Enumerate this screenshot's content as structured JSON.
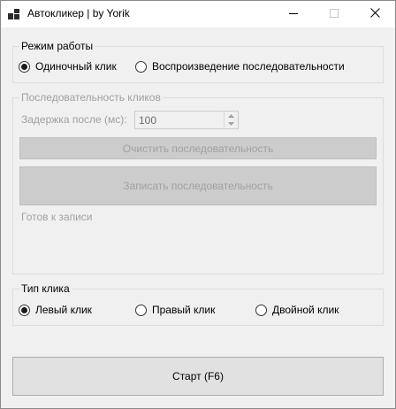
{
  "window": {
    "title": "Автокликер | by Yorik",
    "icon": "app-icon",
    "controls": [
      "minimize-icon",
      "maximize-icon",
      "close-icon"
    ]
  },
  "mode_group": {
    "legend": "Режим работы",
    "options": [
      {
        "label": "Одиночный клик",
        "checked": true
      },
      {
        "label": "Воспроизведение последовательности",
        "checked": false
      }
    ]
  },
  "sequence_group": {
    "legend": "Последовательность кликов",
    "enabled": false,
    "delay_label": "Задержка после (мс):",
    "delay_value": "100",
    "clear_button": "Очистить последовательность",
    "record_button": "Записать последовательность",
    "status": "Готов к записи"
  },
  "click_type_group": {
    "legend": "Тип клика",
    "options": [
      {
        "label": "Левый клик",
        "checked": true
      },
      {
        "label": "Правый клик",
        "checked": false
      },
      {
        "label": "Двойной клик",
        "checked": false
      }
    ]
  },
  "start_button": "Старт (F6)",
  "colors": {
    "window_bg": "#f0f0f0",
    "titlebar_bg": "#ffffff",
    "disabled_text": "#a0a0a0",
    "disabled_button": "#cccccc",
    "button_bg": "#e1e1e1"
  }
}
